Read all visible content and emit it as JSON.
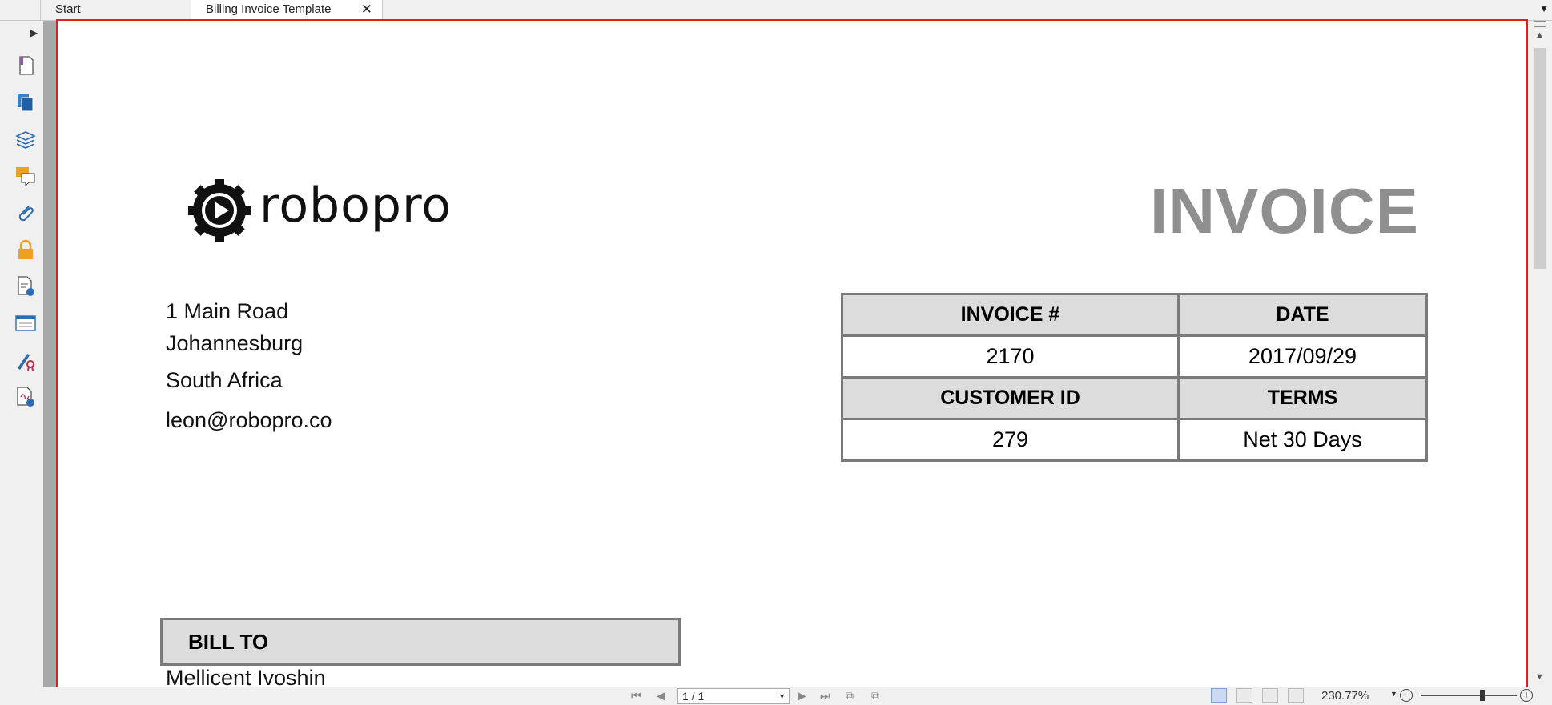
{
  "tabs": [
    {
      "label": "Start"
    },
    {
      "label": "Billing Invoice Template",
      "close": "✕"
    }
  ],
  "tab_overflow": "▼",
  "sidebar": {
    "expand": "▶",
    "items": [
      {
        "icon": "bookmark-icon"
      },
      {
        "icon": "pages-icon"
      },
      {
        "icon": "layers-icon"
      },
      {
        "icon": "comments-icon"
      },
      {
        "icon": "attachment-icon"
      },
      {
        "icon": "security-lock-icon"
      },
      {
        "icon": "document-clock-icon"
      },
      {
        "icon": "form-fields-icon"
      },
      {
        "icon": "sign-certify-icon"
      },
      {
        "icon": "signature-validate-icon"
      }
    ]
  },
  "document": {
    "logo_text": "robopro",
    "address": [
      "1 Main Road",
      "Johannesburg",
      "South Africa"
    ],
    "email": "leon@robopro.co",
    "title": "INVOICE",
    "meta": {
      "invoice_label": "INVOICE #",
      "date_label": "DATE",
      "invoice_value": "2170",
      "date_value": "2017/09/29",
      "customer_label": "CUSTOMER ID",
      "terms_label": "TERMS",
      "customer_value": "279",
      "terms_value": "Net 30 Days"
    },
    "bill_to_label": "BILL TO",
    "customer_name": "Mellicent Ivoshin"
  },
  "statusbar": {
    "page_display": "1 / 1",
    "zoom": "230.77%"
  },
  "colors": {
    "accent_frame": "#e02020",
    "title_gray": "#8f8f8f",
    "header_fill": "#dcdcdc"
  }
}
